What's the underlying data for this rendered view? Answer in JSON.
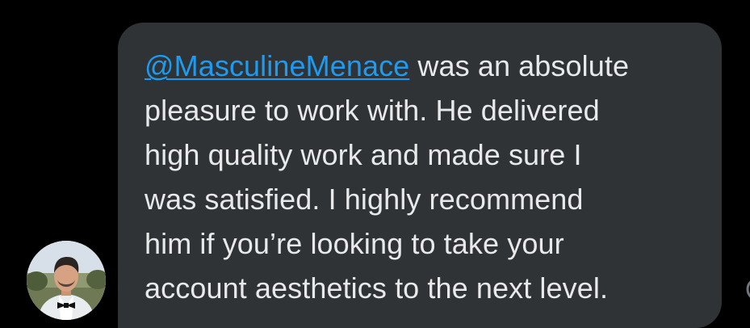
{
  "conversation": {
    "message": {
      "mention": "@MasculineMenace",
      "lines": [
        " was an absolute",
        "pleasure to work with. He delivered",
        "high quality work and made sure I",
        "was satisfied. I highly recommend",
        "him if you’re looking to take your",
        "account aesthetics to the next level."
      ]
    },
    "sender": {
      "avatar_icon": "profile-photo"
    },
    "edge_icon": "reaction-icon"
  },
  "colors": {
    "background": "#000000",
    "bubble": "#2f3336",
    "text": "#e7e9ea",
    "mention": "#1d9bf0"
  }
}
